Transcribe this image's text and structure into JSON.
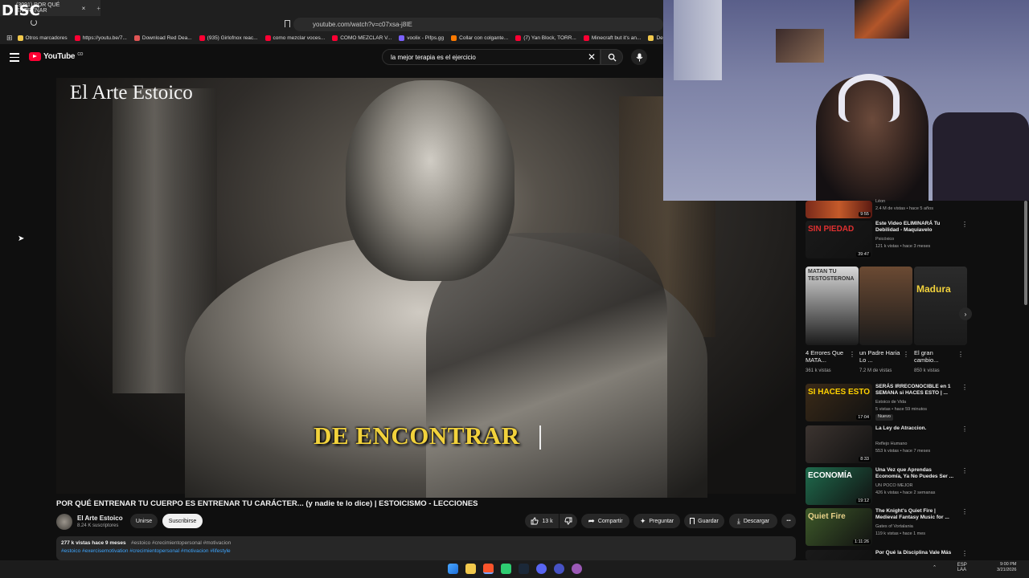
{
  "browser": {
    "tab_title": "(3091) POR QUÉ ENTRENAR",
    "tab_close": "×",
    "tab_new": "+",
    "overlay_logo": "DISC",
    "url": "youtube.com/watch?v=c07xsa-j8IE",
    "bookmarks": [
      {
        "label": "Otros marcadores",
        "color": "#f2c94c"
      },
      {
        "label": "https://youtu.be/7...",
        "color": "#ff0033"
      },
      {
        "label": "Download Red Dea...",
        "color": "#e05555"
      },
      {
        "label": "(935) Girlofnox reac...",
        "color": "#ff0033"
      },
      {
        "label": "como mezclar voces...",
        "color": "#ff0033"
      },
      {
        "label": "COMO MEZCLAR V...",
        "color": "#ff0033"
      },
      {
        "label": "voolix - Pifps.gg",
        "color": "#7b61ff"
      },
      {
        "label": "Collar con colgante...",
        "color": "#ff7a00"
      },
      {
        "label": "(7) Yan Block, TORR...",
        "color": "#ff0033"
      },
      {
        "label": "Minecraft but it's an...",
        "color": "#ff0033"
      },
      {
        "label": "Descargar archi",
        "color": "#f2c94c"
      }
    ]
  },
  "youtube": {
    "logo_text": "YouTube",
    "country_code": "CO",
    "search_value": "la mejor terapia es el ejercicio",
    "clear_symbol": "✕",
    "search_symbol": "⌕",
    "mic_symbol": "🎙"
  },
  "video": {
    "watermark": "El Arte Estoico",
    "caption": "DE ENCONTRAR",
    "title": "POR QUÉ ENTRENAR TU CUERPO ES ENTRENAR TU CARÁCTER... (y nadie te lo dice) | ESTOICISMO - LECCIONES",
    "channel_name": "El Arte Estoico",
    "subscribers": "8.24 K suscriptores",
    "join_label": "Unirse",
    "subscribe_label": "Suscribirse",
    "likes": "13 k",
    "share_label": "Compartir",
    "ask_label": "Preguntar",
    "save_label": "Guardar",
    "download_label": "Descargar",
    "more_label": "•••",
    "views_date": "277 k vistas  hace 9 meses",
    "tags_inline": "#estoico #crecimientopersonal #motivacion",
    "tags_line2": "#estoico #exercisemotivation #crecimientopersonal #motivacion #lifestyle"
  },
  "sidebar": {
    "partial_top": {
      "duration": "9:55",
      "meta": "2.4 M de vistas • hace 5 años",
      "channel": "Léon"
    },
    "videos": [
      {
        "title": "Este Video ELIMINARÁ Tu Debilidad - Maquiavelo",
        "channel": "Psicóxico",
        "meta": "121 k vistas • hace 3 meses",
        "duration": "39:47",
        "thumb_text": "SIN PIEDAD",
        "thumb_color": "#1a1a1a",
        "accent": "#e03030"
      },
      {
        "title": "SERÁS IRRECONOCIBLE en 1 SEMANA si HACES ESTO | ...",
        "channel": "Estoico de Vida",
        "meta": "5 vistas • hace 59 minutos",
        "badge": "Nuevo",
        "duration": "17:04",
        "thumb_text": "SI HACES ESTO",
        "thumb_color": "#3a2a18",
        "accent": "#ffd200"
      },
      {
        "title": "La Ley de Atraccion.",
        "channel": "Reflejo Humano",
        "meta": "553 k vistas • hace 7 meses",
        "duration": "8:33",
        "thumb_text": "",
        "thumb_color": "#3c3430",
        "accent": "#ffffff"
      },
      {
        "title": "Una Vez que Aprendas Economía, Ya No Puedes Ser ...",
        "channel": "UN POCO MEJOR",
        "meta": "426 k vistas • hace 2 semanas",
        "duration": "19:12",
        "thumb_text": "ECONOMÍA",
        "thumb_color": "#1f6b4d",
        "accent": "#ffffff"
      },
      {
        "title": "The Knight's Quiet Fire | Medieval Fantasy Music for ...",
        "channel": "Gates of Vortalania",
        "meta": "119 k vistas • hace 1 mes",
        "duration": "1:11:26",
        "thumb_text": "Quiet Fire",
        "thumb_color": "#3e5a2a",
        "accent": "#e9d28a"
      },
      {
        "title": "Por Qué la Disciplina Vale Más",
        "channel": "",
        "meta": "",
        "duration": "",
        "thumb_text": "",
        "thumb_color": "#1a1a1a",
        "accent": "#ffffff"
      }
    ],
    "shorts": [
      {
        "title": "4 Errores Que MATA...",
        "meta": "361 k vistas",
        "top_text": "MATAN TU TESTOSTERONA",
        "color": "#d9d9d9"
      },
      {
        "title": "un Padre Haria Lo ...",
        "meta": "7.2 M de vistas",
        "top_text": "",
        "color": "#6b4a33"
      },
      {
        "title": "El gran cambio...",
        "meta": "850 k vistas",
        "top_text": "Madura",
        "color": "#2b2b2b"
      }
    ],
    "next_symbol": "›"
  },
  "taskbar": {
    "lang": "ESP\nLAA",
    "time": "9:00 PM",
    "date": "3/21/2026"
  }
}
